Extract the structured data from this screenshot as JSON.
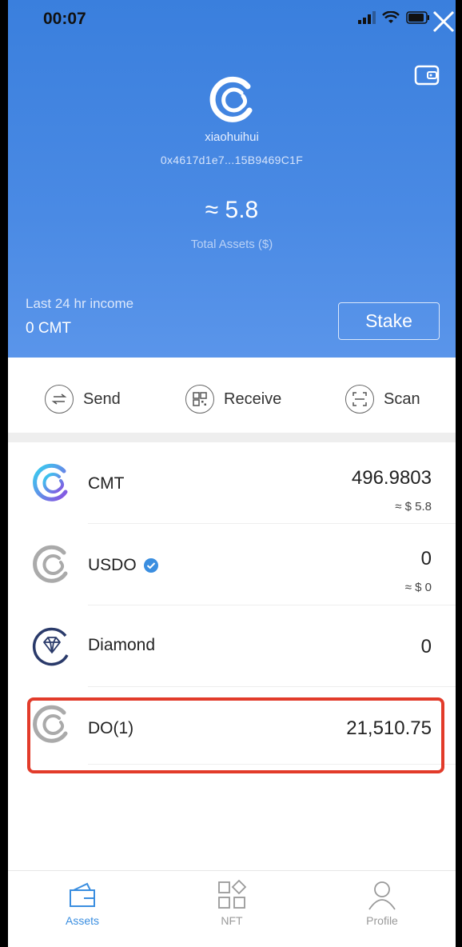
{
  "status_bar": {
    "time": "00:07"
  },
  "account": {
    "name": "xiaohuihui",
    "address": "0x4617d1e7...15B9469C1F",
    "total_value": "≈ 5.8",
    "total_label": "Total Assets ($)"
  },
  "income": {
    "label": "Last 24 hr income",
    "value": "0 CMT"
  },
  "stake": {
    "label": "Stake"
  },
  "actions": {
    "send": "Send",
    "receive": "Receive",
    "scan": "Scan"
  },
  "tokens": [
    {
      "name": "CMT",
      "amount": "496.9803",
      "fiat": "≈ $ 5.8",
      "icon": "cmt-logo-icon"
    },
    {
      "name": "USDO",
      "amount": "0",
      "fiat": "≈ $ 0",
      "icon": "usdo-logo-icon",
      "verified": true
    },
    {
      "name": "Diamond",
      "amount": "0",
      "icon": "diamond-logo-icon"
    },
    {
      "name": "DO(1)",
      "amount": "21,510.75",
      "icon": "do-logo-icon"
    }
  ],
  "nav": {
    "assets": "Assets",
    "nft": "NFT",
    "profile": "Profile",
    "active": "assets"
  },
  "colors": {
    "header_blue": "#4a8ae4",
    "accent": "#3a8ee0",
    "highlight_red": "#e23b2a"
  }
}
